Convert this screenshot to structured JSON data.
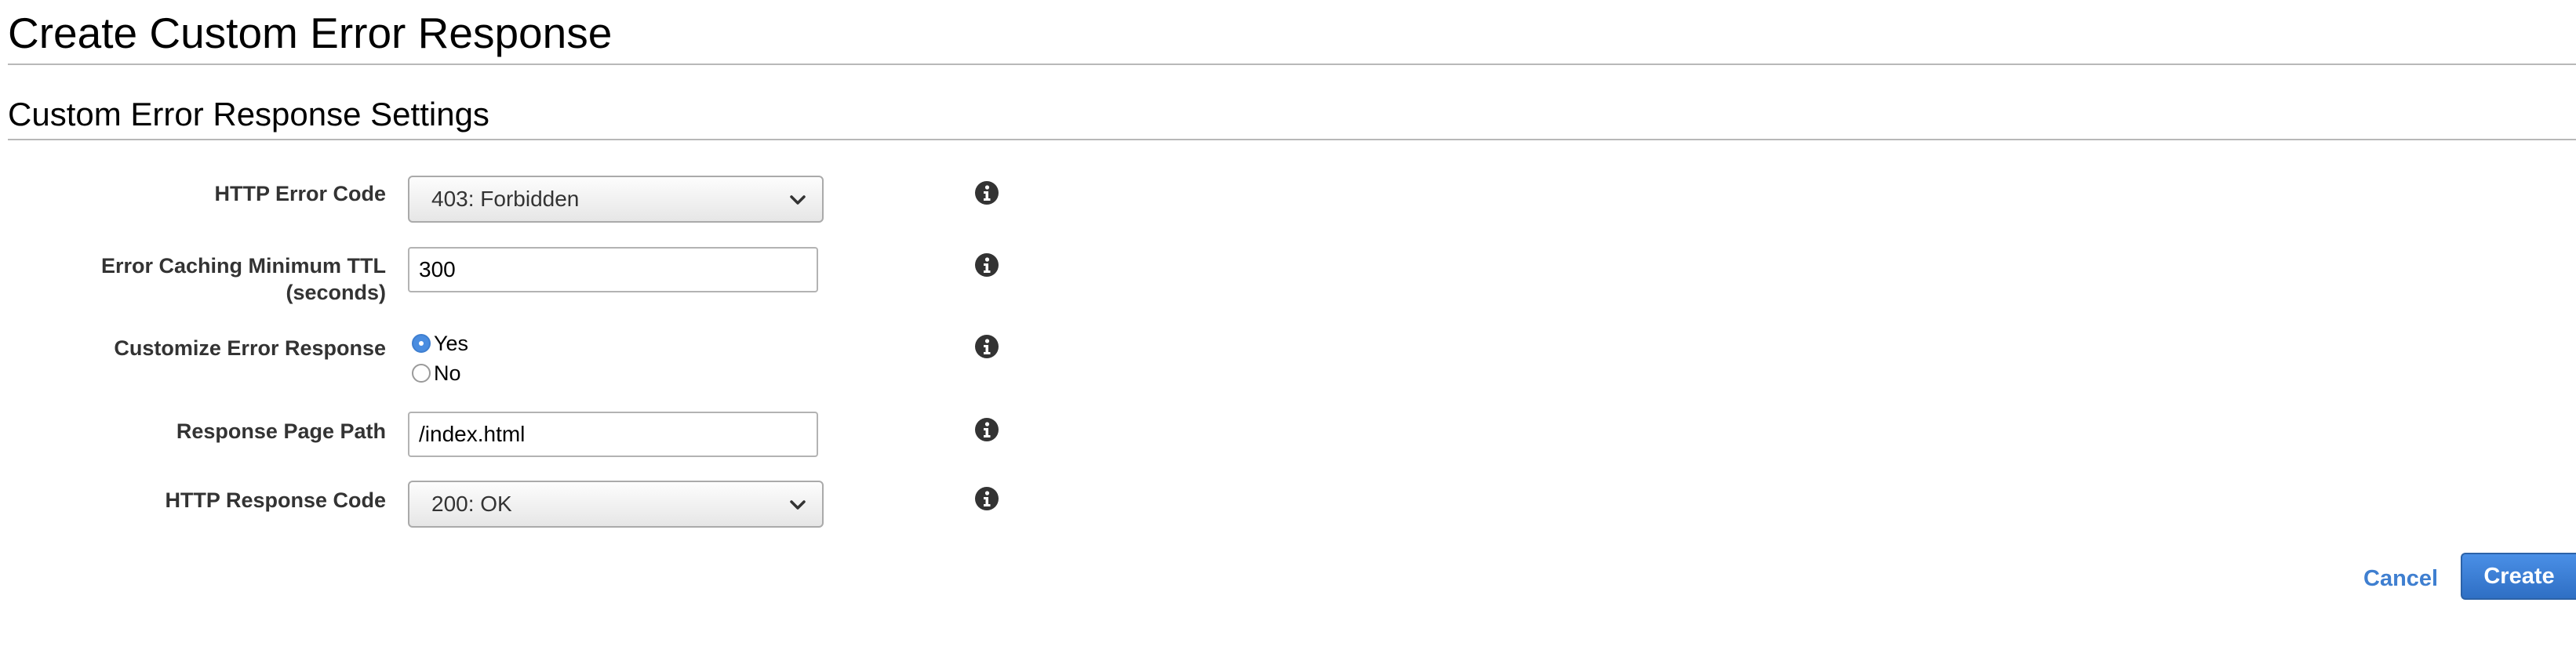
{
  "page": {
    "title": "Create Custom Error Response"
  },
  "section": {
    "title": "Custom Error Response Settings"
  },
  "form": {
    "http_error_code": {
      "label": "HTTP Error Code",
      "selected": "403: Forbidden"
    },
    "error_caching_min_ttl": {
      "label_line1": "Error Caching Minimum TTL",
      "label_line2": "(seconds)",
      "value": "300"
    },
    "customize_error_response": {
      "label": "Customize Error Response",
      "options": [
        "Yes",
        "No"
      ],
      "selected": "Yes"
    },
    "response_page_path": {
      "label": "Response Page Path",
      "value": "/index.html"
    },
    "http_response_code": {
      "label": "HTTP Response Code",
      "selected": "200: OK"
    }
  },
  "actions": {
    "cancel_label": "Cancel",
    "create_label": "Create"
  },
  "icons": {
    "info": "info-icon",
    "dropdown": "chevron-down-icon"
  },
  "colors": {
    "accent": "#3f7fd0",
    "primary_button": "#2f6fc4",
    "icon": "#333333",
    "divider": "#b8b8b8"
  }
}
